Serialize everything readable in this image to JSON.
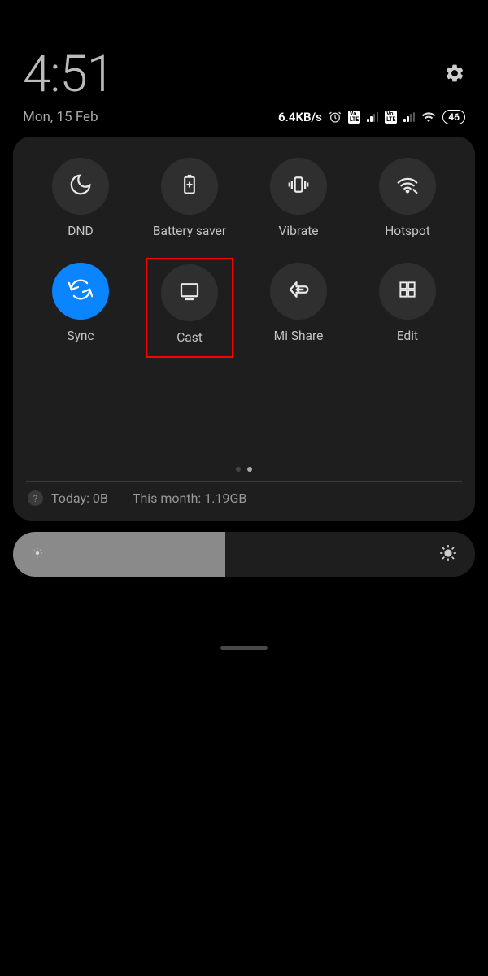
{
  "header": {
    "time": "4:51",
    "date": "Mon, 15 Feb"
  },
  "status": {
    "net_speed": "6.4KB/s",
    "battery_level": "46"
  },
  "tiles": {
    "dnd": "DND",
    "battery_saver": "Battery saver",
    "vibrate": "Vibrate",
    "hotspot": "Hotspot",
    "sync": "Sync",
    "cast": "Cast",
    "mi_share": "Mi Share",
    "edit": "Edit"
  },
  "usage": {
    "today": "Today: 0B",
    "month": "This month: 1.19GB"
  },
  "brightness": {
    "percent": 46
  },
  "highlighted_tile": "cast",
  "active_tiles": [
    "sync"
  ],
  "page_indicator": {
    "count": 2,
    "active": 1
  }
}
